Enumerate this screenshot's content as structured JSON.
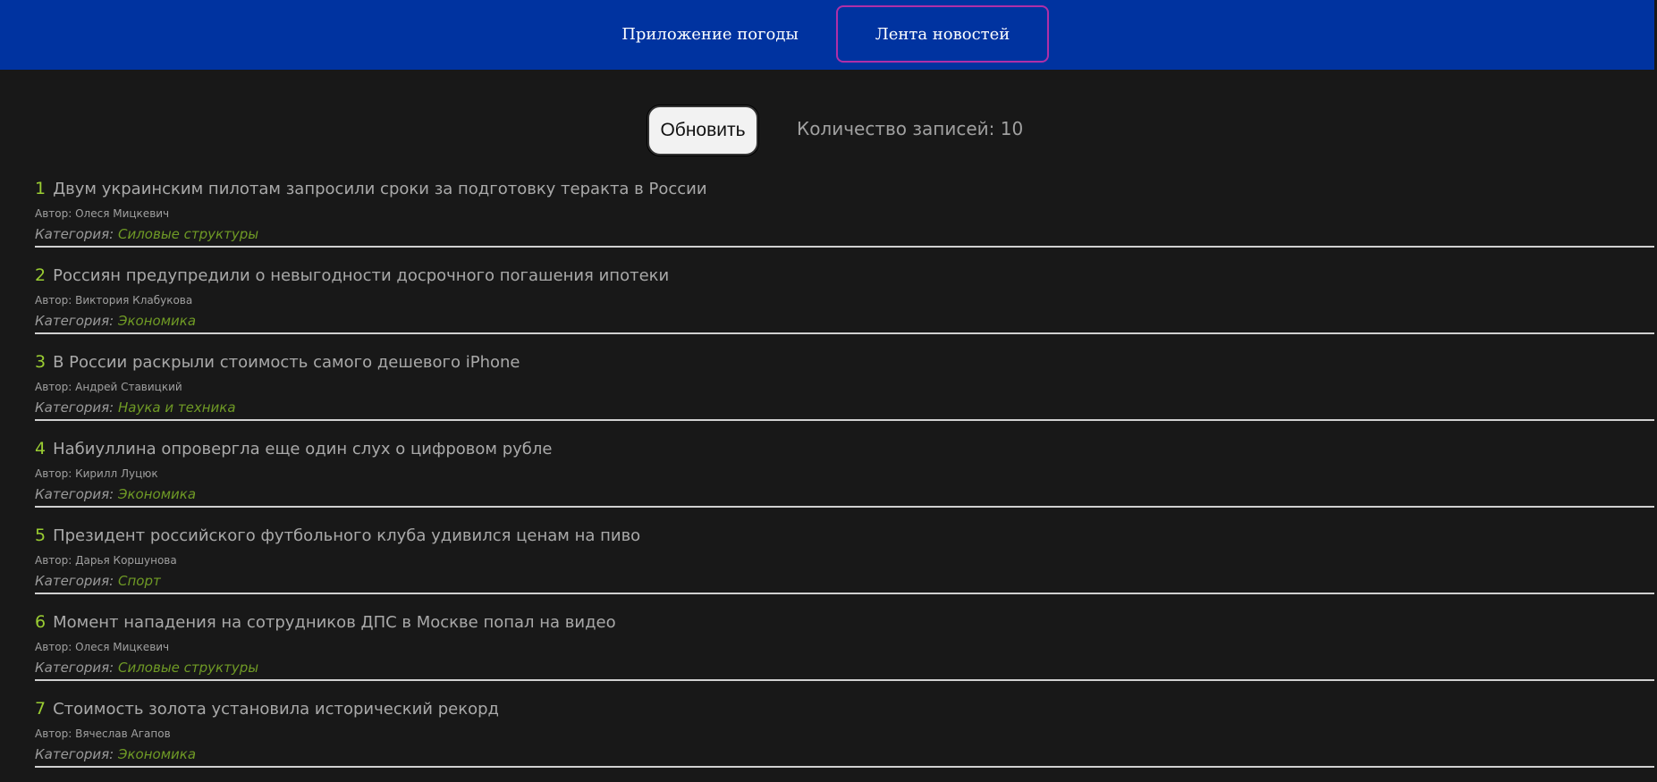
{
  "nav": {
    "tabs": [
      {
        "label": "Приложение погоды"
      },
      {
        "label": "Лента новостей"
      }
    ]
  },
  "controls": {
    "refresh_label": "Обновить",
    "count_text": "Количество записей: 10"
  },
  "news": {
    "author_prefix": "Автор:",
    "category_prefix": "Категория:",
    "items": [
      {
        "num": "1",
        "title": "Двум украинским пилотам запросили сроки за подготовку теракта в России",
        "author": "Олеся Мицкевич",
        "category": "Силовые структуры"
      },
      {
        "num": "2",
        "title": "Россиян предупредили о невыгодности досрочного погашения ипотеки",
        "author": "Виктория Клабукова",
        "category": "Экономика"
      },
      {
        "num": "3",
        "title": "В России раскрыли стоимость самого дешевого iPhone",
        "author": "Андрей Ставицкий",
        "category": "Наука и техника"
      },
      {
        "num": "4",
        "title": "Набиуллина опровергла еще один слух о цифровом рубле",
        "author": "Кирилл Луцюк",
        "category": "Экономика"
      },
      {
        "num": "5",
        "title": "Президент российского футбольного клуба удивился ценам на пиво",
        "author": "Дарья Коршунова",
        "category": "Спорт"
      },
      {
        "num": "6",
        "title": "Момент нападения на сотрудников ДПС в Москве попал на видео",
        "author": "Олеся Мицкевич",
        "category": "Силовые структуры"
      },
      {
        "num": "7",
        "title": "Стоимость золота установила исторический рекорд",
        "author": "Вячеслав Агапов",
        "category": "Экономика"
      }
    ]
  }
}
